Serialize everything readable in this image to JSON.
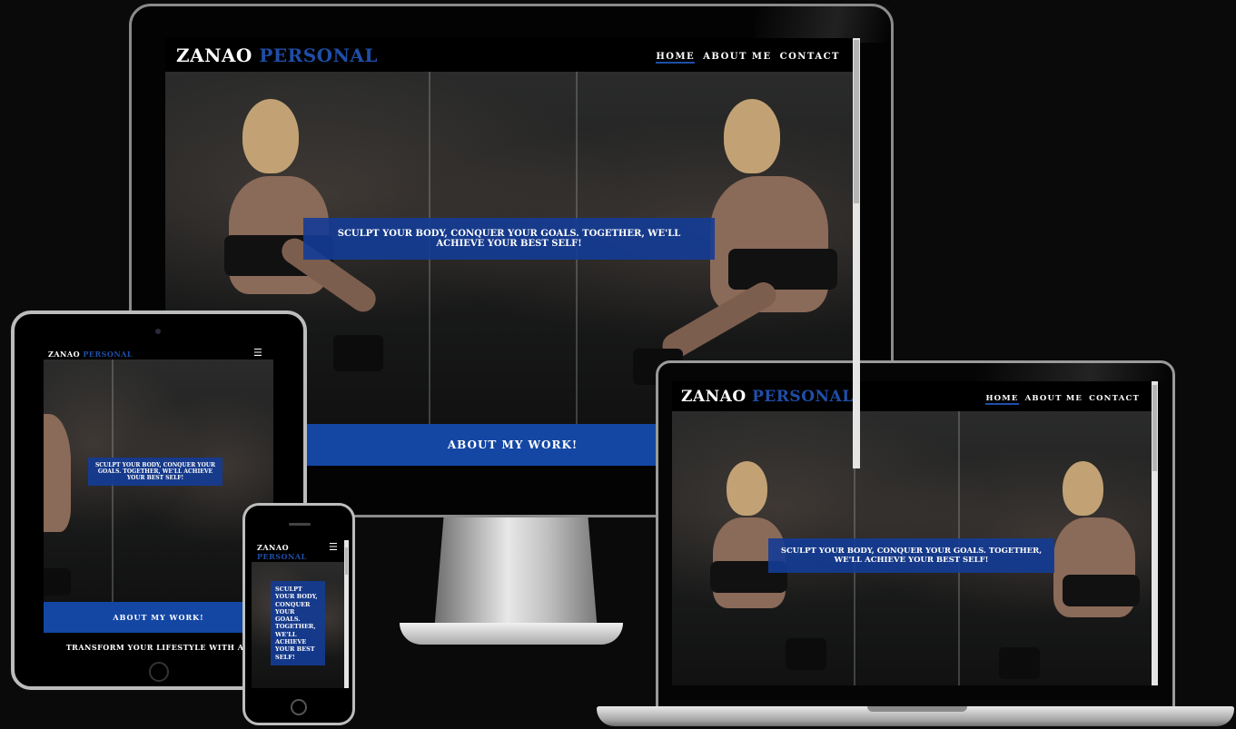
{
  "brand": {
    "name_primary": "ZANAO",
    "name_accent": "PERSONAL",
    "accent_color": "#1f4ea8"
  },
  "nav": {
    "home": "HOME",
    "about": "ABOUT ME",
    "contact": "CONTACT",
    "menu_icon": "hamburger-menu-icon"
  },
  "hero": {
    "tagline": "SCULPT YOUR BODY, CONQUER YOUR GOALS. TOGETHER, WE'LL ACHIEVE YOUR BEST SELF!"
  },
  "cta": {
    "label": "ABOUT MY WORK!"
  },
  "section": {
    "heading": "TRANSFORM YOUR LIFESTYLE WITH AN"
  }
}
